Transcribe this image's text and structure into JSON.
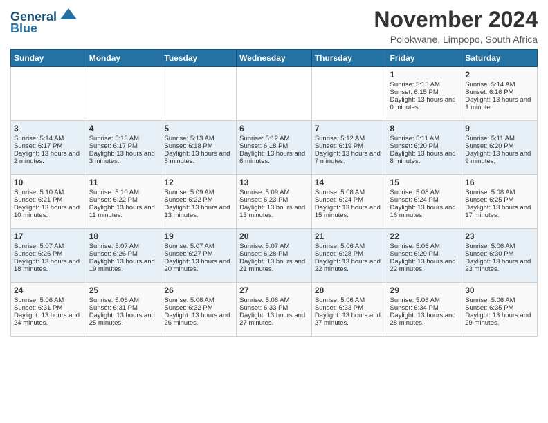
{
  "header": {
    "logo_line1": "General",
    "logo_line2": "Blue",
    "month": "November 2024",
    "location": "Polokwane, Limpopo, South Africa"
  },
  "days_of_week": [
    "Sunday",
    "Monday",
    "Tuesday",
    "Wednesday",
    "Thursday",
    "Friday",
    "Saturday"
  ],
  "weeks": [
    [
      {
        "day": "",
        "empty": true
      },
      {
        "day": "",
        "empty": true
      },
      {
        "day": "",
        "empty": true
      },
      {
        "day": "",
        "empty": true
      },
      {
        "day": "",
        "empty": true
      },
      {
        "day": "1",
        "sunrise": "Sunrise: 5:15 AM",
        "sunset": "Sunset: 6:15 PM",
        "daylight": "Daylight: 13 hours and 0 minutes."
      },
      {
        "day": "2",
        "sunrise": "Sunrise: 5:14 AM",
        "sunset": "Sunset: 6:16 PM",
        "daylight": "Daylight: 13 hours and 1 minute."
      }
    ],
    [
      {
        "day": "3",
        "sunrise": "Sunrise: 5:14 AM",
        "sunset": "Sunset: 6:17 PM",
        "daylight": "Daylight: 13 hours and 2 minutes."
      },
      {
        "day": "4",
        "sunrise": "Sunrise: 5:13 AM",
        "sunset": "Sunset: 6:17 PM",
        "daylight": "Daylight: 13 hours and 3 minutes."
      },
      {
        "day": "5",
        "sunrise": "Sunrise: 5:13 AM",
        "sunset": "Sunset: 6:18 PM",
        "daylight": "Daylight: 13 hours and 5 minutes."
      },
      {
        "day": "6",
        "sunrise": "Sunrise: 5:12 AM",
        "sunset": "Sunset: 6:18 PM",
        "daylight": "Daylight: 13 hours and 6 minutes."
      },
      {
        "day": "7",
        "sunrise": "Sunrise: 5:12 AM",
        "sunset": "Sunset: 6:19 PM",
        "daylight": "Daylight: 13 hours and 7 minutes."
      },
      {
        "day": "8",
        "sunrise": "Sunrise: 5:11 AM",
        "sunset": "Sunset: 6:20 PM",
        "daylight": "Daylight: 13 hours and 8 minutes."
      },
      {
        "day": "9",
        "sunrise": "Sunrise: 5:11 AM",
        "sunset": "Sunset: 6:20 PM",
        "daylight": "Daylight: 13 hours and 9 minutes."
      }
    ],
    [
      {
        "day": "10",
        "sunrise": "Sunrise: 5:10 AM",
        "sunset": "Sunset: 6:21 PM",
        "daylight": "Daylight: 13 hours and 10 minutes."
      },
      {
        "day": "11",
        "sunrise": "Sunrise: 5:10 AM",
        "sunset": "Sunset: 6:22 PM",
        "daylight": "Daylight: 13 hours and 11 minutes."
      },
      {
        "day": "12",
        "sunrise": "Sunrise: 5:09 AM",
        "sunset": "Sunset: 6:22 PM",
        "daylight": "Daylight: 13 hours and 13 minutes."
      },
      {
        "day": "13",
        "sunrise": "Sunrise: 5:09 AM",
        "sunset": "Sunset: 6:23 PM",
        "daylight": "Daylight: 13 hours and 13 minutes."
      },
      {
        "day": "14",
        "sunrise": "Sunrise: 5:08 AM",
        "sunset": "Sunset: 6:24 PM",
        "daylight": "Daylight: 13 hours and 15 minutes."
      },
      {
        "day": "15",
        "sunrise": "Sunrise: 5:08 AM",
        "sunset": "Sunset: 6:24 PM",
        "daylight": "Daylight: 13 hours and 16 minutes."
      },
      {
        "day": "16",
        "sunrise": "Sunrise: 5:08 AM",
        "sunset": "Sunset: 6:25 PM",
        "daylight": "Daylight: 13 hours and 17 minutes."
      }
    ],
    [
      {
        "day": "17",
        "sunrise": "Sunrise: 5:07 AM",
        "sunset": "Sunset: 6:26 PM",
        "daylight": "Daylight: 13 hours and 18 minutes."
      },
      {
        "day": "18",
        "sunrise": "Sunrise: 5:07 AM",
        "sunset": "Sunset: 6:26 PM",
        "daylight": "Daylight: 13 hours and 19 minutes."
      },
      {
        "day": "19",
        "sunrise": "Sunrise: 5:07 AM",
        "sunset": "Sunset: 6:27 PM",
        "daylight": "Daylight: 13 hours and 20 minutes."
      },
      {
        "day": "20",
        "sunrise": "Sunrise: 5:07 AM",
        "sunset": "Sunset: 6:28 PM",
        "daylight": "Daylight: 13 hours and 21 minutes."
      },
      {
        "day": "21",
        "sunrise": "Sunrise: 5:06 AM",
        "sunset": "Sunset: 6:28 PM",
        "daylight": "Daylight: 13 hours and 22 minutes."
      },
      {
        "day": "22",
        "sunrise": "Sunrise: 5:06 AM",
        "sunset": "Sunset: 6:29 PM",
        "daylight": "Daylight: 13 hours and 22 minutes."
      },
      {
        "day": "23",
        "sunrise": "Sunrise: 5:06 AM",
        "sunset": "Sunset: 6:30 PM",
        "daylight": "Daylight: 13 hours and 23 minutes."
      }
    ],
    [
      {
        "day": "24",
        "sunrise": "Sunrise: 5:06 AM",
        "sunset": "Sunset: 6:31 PM",
        "daylight": "Daylight: 13 hours and 24 minutes."
      },
      {
        "day": "25",
        "sunrise": "Sunrise: 5:06 AM",
        "sunset": "Sunset: 6:31 PM",
        "daylight": "Daylight: 13 hours and 25 minutes."
      },
      {
        "day": "26",
        "sunrise": "Sunrise: 5:06 AM",
        "sunset": "Sunset: 6:32 PM",
        "daylight": "Daylight: 13 hours and 26 minutes."
      },
      {
        "day": "27",
        "sunrise": "Sunrise: 5:06 AM",
        "sunset": "Sunset: 6:33 PM",
        "daylight": "Daylight: 13 hours and 27 minutes."
      },
      {
        "day": "28",
        "sunrise": "Sunrise: 5:06 AM",
        "sunset": "Sunset: 6:33 PM",
        "daylight": "Daylight: 13 hours and 27 minutes."
      },
      {
        "day": "29",
        "sunrise": "Sunrise: 5:06 AM",
        "sunset": "Sunset: 6:34 PM",
        "daylight": "Daylight: 13 hours and 28 minutes."
      },
      {
        "day": "30",
        "sunrise": "Sunrise: 5:06 AM",
        "sunset": "Sunset: 6:35 PM",
        "daylight": "Daylight: 13 hours and 29 minutes."
      }
    ]
  ]
}
